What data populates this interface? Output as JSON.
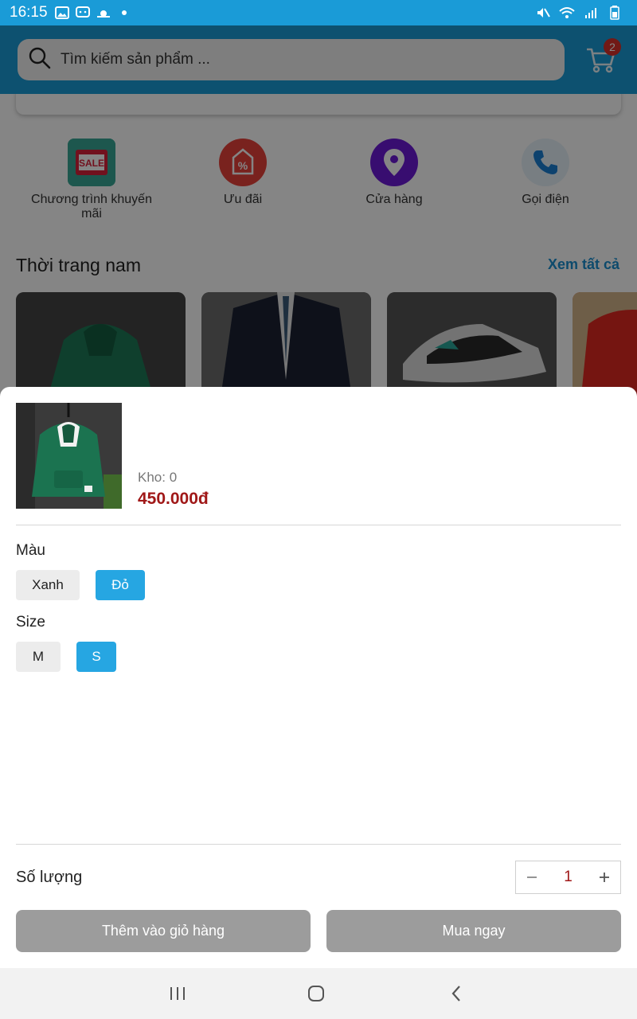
{
  "status_bar": {
    "time": "16:15"
  },
  "header": {
    "search_placeholder": "Tìm kiếm sản phẩm ...",
    "cart_count": "2"
  },
  "home": {
    "categories": [
      {
        "label": "Chương trình khuyến mãi",
        "icon": "sale-tag-icon"
      },
      {
        "label": "Ưu đãi",
        "icon": "discount-percent-icon"
      },
      {
        "label": "Cửa hàng",
        "icon": "location-pin-icon"
      },
      {
        "label": "Gọi điện",
        "icon": "phone-icon"
      }
    ],
    "section_title": "Thời trang nam",
    "see_all": "Xem tất cả"
  },
  "sheet": {
    "stock": "Kho: 0",
    "price": "450.000đ",
    "color_title": "Màu",
    "colors": [
      {
        "label": "Xanh",
        "selected": false
      },
      {
        "label": "Đỏ",
        "selected": true
      }
    ],
    "size_title": "Size",
    "sizes": [
      {
        "label": "M",
        "selected": false
      },
      {
        "label": "S",
        "selected": true
      }
    ],
    "quantity_label": "Số lượng",
    "quantity": "1",
    "add_to_cart": "Thêm vào giỏ hàng",
    "buy_now": "Mua ngay"
  },
  "colors": {
    "primary": "#1a9bd7",
    "chip_selected": "#26a6e2",
    "price": "#a01818",
    "badge": "#d9302b",
    "action_disabled": "#9c9c9c"
  }
}
